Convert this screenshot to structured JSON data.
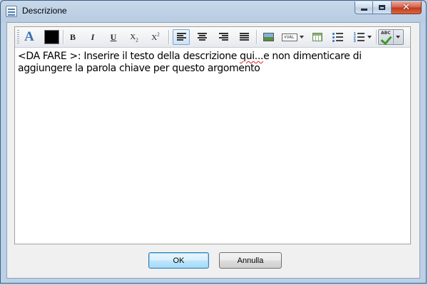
{
  "window": {
    "title": "Descrizione"
  },
  "toolbar": {
    "font_glyph": "A",
    "bold": "B",
    "italic": "I",
    "underline": "U",
    "subscript": "X",
    "subscript_mark": "2",
    "superscript": "X",
    "superscript_mark": "2",
    "field_glyph": "#VAL",
    "spell_glyph": "ABC",
    "text_color": "#000000"
  },
  "editor": {
    "text_before": "<DA FARE >: Inserire il testo della descrizione ",
    "misspelled": "qui...",
    "text_after": "e non dimenticare di aggiungere la parola chiave per questo argomento"
  },
  "buttons": {
    "ok": "OK",
    "cancel": "Annulla"
  }
}
